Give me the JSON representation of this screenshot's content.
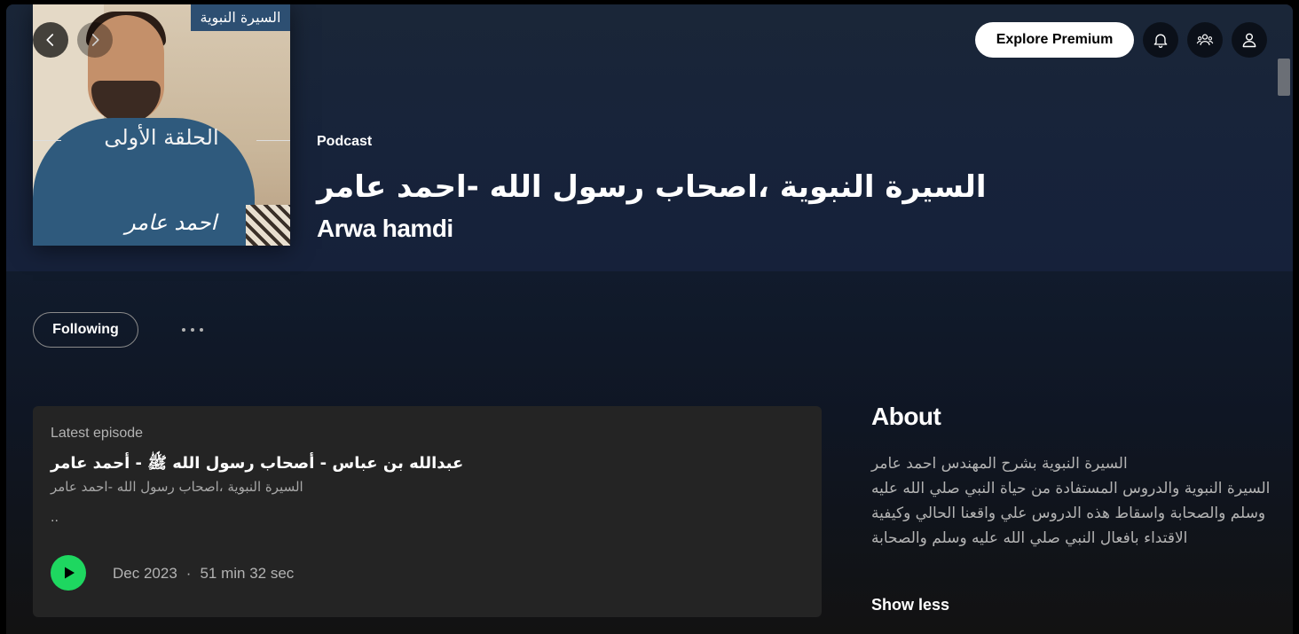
{
  "header": {
    "back_label": "Go back",
    "forward_label": "Go forward",
    "premium_label": "Explore Premium",
    "icons": [
      "bell-icon",
      "friends-icon",
      "user-icon"
    ]
  },
  "cover": {
    "badge_text": "السيرة النبوية",
    "episode_title": "الحلقة الأولى",
    "signature": "احمد عامر"
  },
  "podcast": {
    "type": "Podcast",
    "title": "السيرة النبوية ،اصحاب رسول الله -احمد عامر",
    "author": "Arwa hamdi"
  },
  "actions": {
    "follow_label": "Following"
  },
  "latest_episode": {
    "label": "Latest episode",
    "title": "عبدالله بن عباس - أصحاب رسول الله ﷺ - أحمد عامر",
    "show": "السيرة النبوية ،اصحاب رسول الله -احمد عامر",
    "description": "..",
    "date": "Dec 2023",
    "separator": "·",
    "duration": "51 min 32 sec"
  },
  "about": {
    "heading": "About",
    "text": "السيرة النبوية بشرح المهندس احمد عامر\nالسيرة النبوية والدروس المستفادة من حياة النبي صلي الله عليه وسلم والصحابة واسقاط هذه الدروس علي واقعنا الحالي وكيفية الاقتداء بافعال النبي صلي الله عليه وسلم والصحابة",
    "toggle_label": "Show less"
  },
  "colors": {
    "accent": "#1ed760",
    "background": "#121212",
    "hero": "#1a2638",
    "card": "#242424"
  }
}
